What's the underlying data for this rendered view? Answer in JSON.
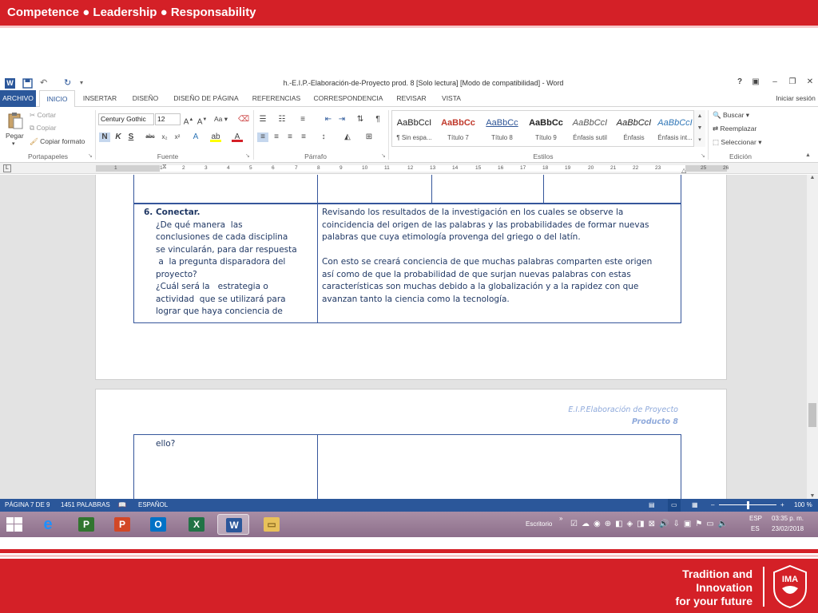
{
  "slide": {
    "top_text": "Competence ● Leadership ● Responsability",
    "tagline": [
      "Tradition and",
      "Innovation",
      "for your future"
    ],
    "logo_text": "IMA"
  },
  "window": {
    "title": "h.-E.I.P.-Elaboración-de-Proyecto prod. 8 [Solo lectura] [Modo de compatibilidad] - Word",
    "help": "?",
    "signin": "Iniciar sesión"
  },
  "tabs": [
    "ARCHIVO",
    "INICIO",
    "INSERTAR",
    "DISEÑO",
    "DISEÑO DE PÁGINA",
    "REFERENCIAS",
    "CORRESPONDENCIA",
    "REVISAR",
    "VISTA"
  ],
  "ribbon": {
    "clipboard": {
      "paste": "Pegar",
      "cut": "Cortar",
      "copy": "Copiar",
      "format_painter": "Copiar formato",
      "label": "Portapapeles"
    },
    "font": {
      "name": "Century Gothic",
      "size": "12",
      "label": "Fuente",
      "bold": "N",
      "italic": "K",
      "underline": "S",
      "case": "Aa"
    },
    "paragraph": {
      "label": "Párrafo"
    },
    "styles": {
      "label": "Estilos",
      "items": [
        {
          "sample": "AaBbCcI",
          "name": "¶ Sin espa...",
          "color": "#222222"
        },
        {
          "sample": "AaBbCc",
          "name": "Título 7",
          "color": "#c0392b"
        },
        {
          "sample": "AaBbCc",
          "name": "Título 8",
          "color": "#2e5597"
        },
        {
          "sample": "AaBbCc",
          "name": "Título 9",
          "color": "#222222"
        },
        {
          "sample": "AaBbCcI",
          "name": "Énfasis sutil",
          "color": "#444444"
        },
        {
          "sample": "AaBbCcI",
          "name": "Énfasis",
          "color": "#222222"
        },
        {
          "sample": "AaBbCcI",
          "name": "Énfasis int...",
          "color": "#2e75b6"
        }
      ]
    },
    "editing": {
      "find": "Buscar",
      "replace": "Reemplazar",
      "select": "Seleccionar",
      "label": "Edición"
    }
  },
  "ruler": {
    "numbers": [
      "1",
      "1",
      "2",
      "3",
      "4",
      "5",
      "6",
      "7",
      "8",
      "9",
      "10",
      "11",
      "12",
      "13",
      "14",
      "15",
      "16",
      "17",
      "18",
      "19",
      "20",
      "21",
      "22",
      "23",
      "25",
      "26"
    ]
  },
  "document": {
    "left_heading": "6. Conectar.",
    "left_lines": [
      "¿De qué manera  las",
      "conclusiones de cada disciplina",
      "se vincularán, para dar respuesta",
      " a  la pregunta disparadora del",
      "proyecto?",
      "¿Cuál será la   estrategia o",
      "actividad  que se utilizará para",
      "lograr que haya conciencia de"
    ],
    "right_lines": [
      "Revisando los resultados de la investigación en los cuales se observe la",
      "coincidencia del origen de las palabras y las probabilidades de formar nuevas",
      "palabras que cuya etimología provenga del griego o del latín.",
      "",
      "Con esto se creará conciencia de que muchas palabras comparten este origen",
      "así como de que la probabilidad de que surjan nuevas palabras con estas",
      "características son muchas debido a la globalización y a la rapidez con que",
      "avanzan tanto la ciencia como la tecnología."
    ],
    "page2_header1": "E.I.P.Elaboración de Proyecto",
    "page2_header2": "Producto 8",
    "page2_left": "ello?"
  },
  "statusbar": {
    "page": "PÁGINA 7 DE 9",
    "words": "1451 PALABRAS",
    "lang": "ESPAÑOL",
    "zoom": "100 %",
    "zoom_level": 0.5
  },
  "taskbar": {
    "desktop": "Escritorio",
    "lang_top": "ESP",
    "lang_bottom": "ES",
    "time": "03:35 p. m.",
    "date": "23/02/2018"
  },
  "colors": {
    "brand_red": "#d42027",
    "word_blue": "#2b579a",
    "text_blue": "#203864"
  }
}
